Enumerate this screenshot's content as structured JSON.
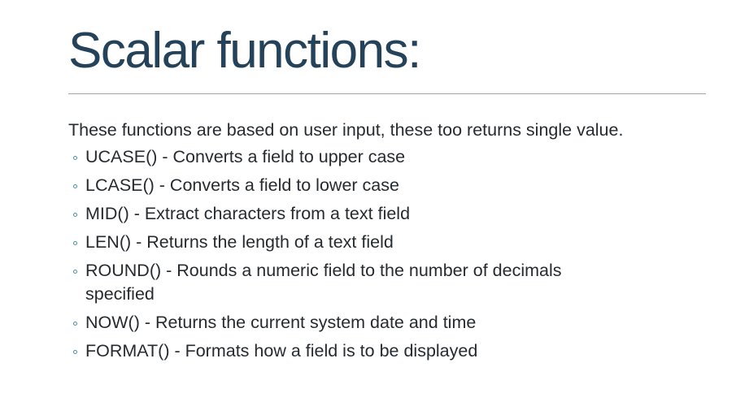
{
  "slide": {
    "title": "Scalar functions:",
    "intro": "These functions are based on user input, these too returns single value.",
    "items": [
      {
        "text": "UCASE() - Converts a field to upper case"
      },
      {
        "text": "LCASE() - Converts a field to lower case"
      },
      {
        "text": "MID() - Extract characters from a text field"
      },
      {
        "text": "LEN() - Returns the length of a text field"
      },
      {
        "text": "ROUND() - Rounds a numeric field to the number of decimals specified"
      },
      {
        "text": "NOW() - Returns the current system date and time"
      },
      {
        "text": "FORMAT() - Formats how a field is to be displayed"
      }
    ]
  },
  "colors": {
    "title": "#24425a",
    "body_text": "#262b30",
    "divider": "#a6a6a6",
    "bullet": "#4e8fa3",
    "background": "#ffffff"
  },
  "icons": {
    "bullet": "hollow-circle-bullet-icon"
  }
}
